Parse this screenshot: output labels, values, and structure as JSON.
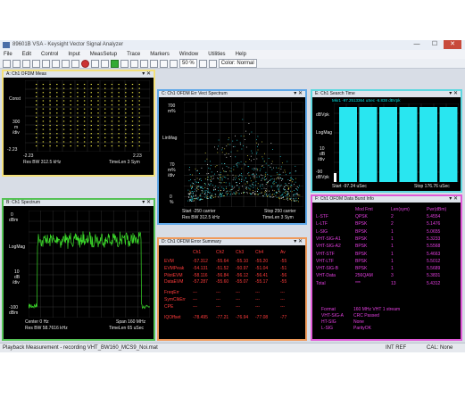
{
  "app": {
    "title": "89601B VSA - Keysight Vector Signal Analyzer",
    "menu": [
      "File",
      "Edit",
      "Control",
      "Input",
      "MeasSetup",
      "Trace",
      "Markers",
      "Window",
      "Utilities",
      "Help"
    ],
    "toolbar": {
      "zoom": "50 %",
      "color_mode": "Color: Normal"
    }
  },
  "colors": {
    "frame_yellow": "#f3e07a",
    "frame_green": "#55c255",
    "frame_blue": "#5fa8e8",
    "frame_cyan": "#5fd8e0",
    "frame_magenta": "#e15ad8",
    "frame_orange": "#f09a5a",
    "trace_green": "#3bd92a",
    "trace_cyan": "#29e6f0",
    "trace_yellow": "#e8e244",
    "table_magenta": "#e43ee0",
    "table_red": "#ff3b3b"
  },
  "panels": {
    "a": {
      "title": "A: Ch1 OFDM Meas",
      "ref": "Const",
      "div_val": "300",
      "div_unit": "m",
      "div_label": "/div",
      "xmin": "-2.23",
      "xmax": "2.23",
      "ymin": "-2.23",
      "bottom_left": "Res BW 312.5 kHz",
      "bottom_right": "TimeLen 3   Sym"
    },
    "b": {
      "title": "B: Ch1 Spectrum",
      "top": "0",
      "unit": "dBm",
      "ref": "LogMag",
      "div_val": "10",
      "div_unit": "dB",
      "div_label": "/div",
      "bottom": "-100",
      "bottom_unit": "dBm",
      "center": "Center 0  Hz",
      "span": "Span 160 MHz",
      "rbw": "Res BW 58.7616 kHz",
      "timelen": "TimeLen 65 uSec"
    },
    "c": {
      "title": "C: Ch1 OFDM Err Vect Spectrum",
      "top": "700",
      "top_unit": "m%",
      "ref": "LinMag",
      "div_val": "70",
      "div_unit": "m%",
      "div_label": "/div",
      "bottom": "0",
      "bottom_unit": "%",
      "start": "Start -250  carrier",
      "stop": "Stop 250  carrier",
      "rbw": "Res BW 312.5 kHz",
      "timelen": "TimeLen 3   Sym"
    },
    "d": {
      "title": "D: Ch1 OFDM Error Summary",
      "headers": [
        "Ch1",
        "Ch2",
        "Ch3",
        "Ch4",
        "Av"
      ],
      "rows": [
        {
          "label": "EVM",
          "values": [
            "-57.312",
            "-55.64",
            "-55.10",
            "-55.20",
            "-55"
          ]
        },
        {
          "label": "EVMPeak",
          "values": [
            "-54.131",
            "-51.52",
            "-50.97",
            "-51.04",
            "-51"
          ]
        },
        {
          "label": "PilotEVM",
          "values": [
            "-58.116",
            "-56.84",
            "-56.12",
            "-56.41",
            "-56"
          ]
        },
        {
          "label": "DataEVM",
          "values": [
            "-57.287",
            "-55.60",
            "-55.07",
            "-55.17",
            "-55"
          ]
        },
        {
          "label": "FreqErr",
          "values": [
            "---",
            "---",
            "---",
            "---",
            "---"
          ]
        },
        {
          "label": "SymClkErr",
          "values": [
            "---",
            "---",
            "---",
            "---",
            "---"
          ]
        },
        {
          "label": "CPE",
          "values": [
            "---",
            "---",
            "---",
            "---",
            "---"
          ]
        },
        {
          "label": "IQOffset",
          "values": [
            "-78.495",
            "-77.21",
            "-76.94",
            "-77.08",
            "-77"
          ]
        }
      ]
    },
    "e": {
      "title": "E: Ch1 Search Time",
      "marker": "Mkr1  -97.2513364 uSec   -6.838 dBVpk",
      "unit": "dBVpk",
      "ref": "LogMag",
      "div_val": "10",
      "div_unit": "dB",
      "div_label": "/div",
      "bottom": "-90",
      "bottom_unit": "dBVpk",
      "start": "Start -97.24 uSec",
      "stop": "Stop 176.76 uSec"
    },
    "f": {
      "title": "F: Ch1 OFDM Data Burst Info",
      "headers": [
        "",
        "Mod Fmt",
        "Len(sym)",
        "Pwr(dBm)"
      ],
      "rows": [
        {
          "name": "L-STF",
          "mod": "QPSK",
          "len": "2",
          "pwr": "5.4554"
        },
        {
          "name": "L-LTF",
          "mod": "BPSK",
          "len": "2",
          "pwr": "5.1476"
        },
        {
          "name": "L-SIG",
          "mod": "BPSK",
          "len": "1",
          "pwr": "5.0655"
        },
        {
          "name": "VHT-SIG-A1",
          "mod": "BPSK",
          "len": "1",
          "pwr": "5.3233"
        },
        {
          "name": "VHT-SIG-A2",
          "mod": "BPSK",
          "len": "1",
          "pwr": "5.5568"
        },
        {
          "name": "VHT-STF",
          "mod": "BPSK",
          "len": "1",
          "pwr": "5.4663"
        },
        {
          "name": "VHT-LTF",
          "mod": "BPSK",
          "len": "1",
          "pwr": "5.5012"
        },
        {
          "name": "VHT-SIG-B",
          "mod": "BPSK",
          "len": "1",
          "pwr": "5.5689"
        },
        {
          "name": "VHT-Data",
          "mod": "256QAM",
          "len": "3",
          "pwr": "5.3831"
        },
        {
          "name": "Total",
          "mod": "***",
          "len": "13",
          "pwr": "5.4312"
        }
      ],
      "format_label": "Format",
      "format_value": "160 MHz VHT 1 stream",
      "sig_label": "VHT-SIG-A",
      "sig_value": "CRC Passed",
      "htsig_label": "HT-SIG",
      "htsig_value": "None",
      "lsig_label": "L-SIG",
      "lsig_value": "ParityOK"
    }
  },
  "status": {
    "message": "Playback Measurement - recording VHT_BW160_MCS9_Noi.mat",
    "ref": "INT REF",
    "cal": "CAL: None"
  }
}
